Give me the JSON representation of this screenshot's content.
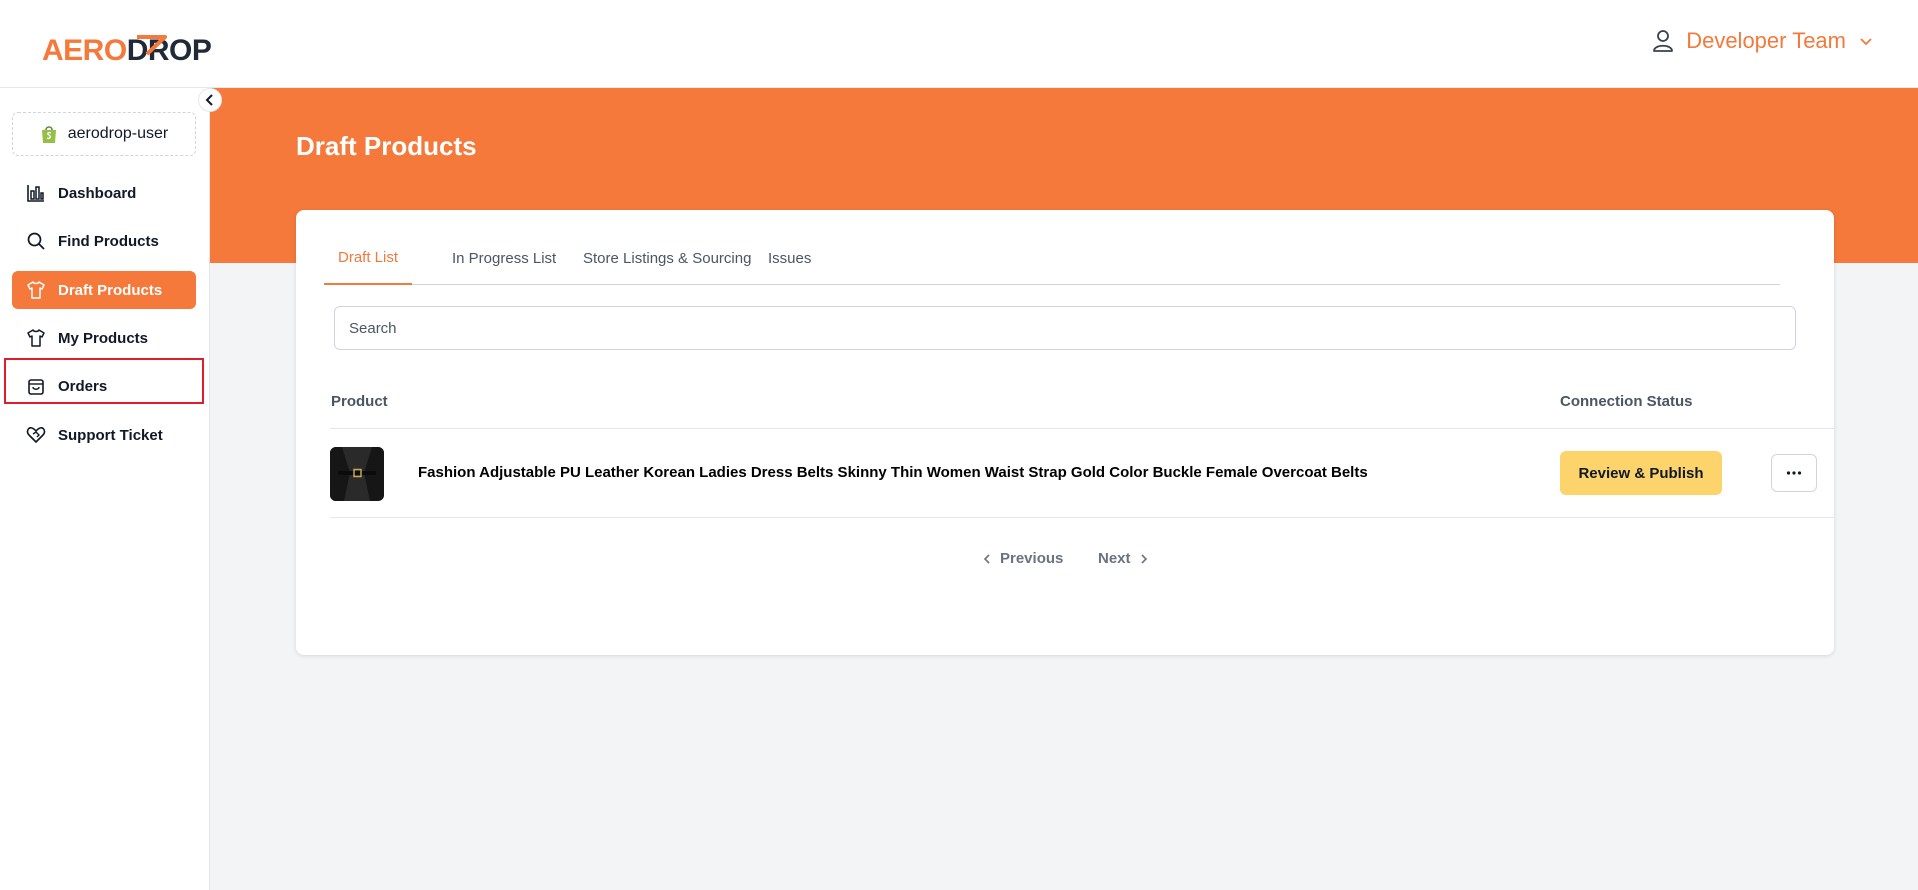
{
  "brand": {
    "logo_aero": "AER",
    "logo_o": "O",
    "logo_drop": "DROP",
    "accent": "#f4793b",
    "button_yellow": "#fcd46b",
    "highlight_red": "#e11d2a"
  },
  "header": {
    "user_name": "Developer Team",
    "user_icon": "user-icon",
    "dropdown_icon": "chevron-down-icon"
  },
  "sidebar": {
    "store_name": "aerodrop-user",
    "store_icon": "shopify-bag-icon",
    "items": [
      {
        "label": "Dashboard",
        "icon": "bar-chart-icon",
        "active": false
      },
      {
        "label": "Find Products",
        "icon": "search-icon",
        "active": false
      },
      {
        "label": "Draft Products",
        "icon": "tshirt-icon",
        "active": true
      },
      {
        "label": "My Products",
        "icon": "tshirt-icon",
        "active": false
      },
      {
        "label": "Orders",
        "icon": "shopping-bag-icon",
        "active": false
      },
      {
        "label": "Support Ticket",
        "icon": "heart-handshake-icon",
        "active": false
      }
    ]
  },
  "page": {
    "title": "Draft Products"
  },
  "tabs": [
    {
      "label": "Draft List",
      "active": true
    },
    {
      "label": "In Progress List",
      "active": false
    },
    {
      "label": "Store Listings & Sourcing",
      "active": false
    },
    {
      "label": "Issues",
      "active": false
    }
  ],
  "search": {
    "placeholder": "Search",
    "value": ""
  },
  "table": {
    "columns": [
      "Product",
      "Connection Status"
    ],
    "rows": [
      {
        "title": "Fashion Adjustable PU Leather Korean Ladies Dress Belts Skinny Thin Women Waist Strap Gold Color Buckle Female Overcoat Belts",
        "action_label": "Review & Publish",
        "more_icon": "ellipsis-icon"
      }
    ]
  },
  "pagination": {
    "previous": "Previous",
    "next": "Next"
  }
}
